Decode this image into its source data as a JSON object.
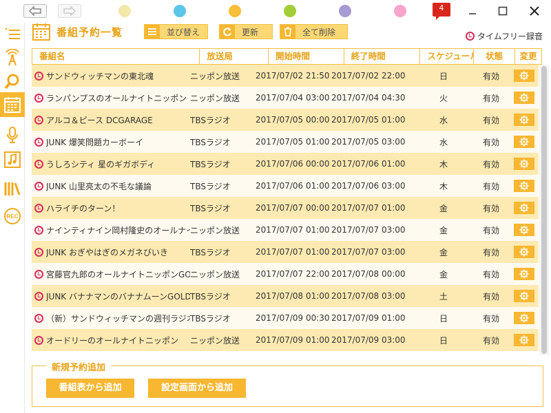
{
  "titlebar": {
    "back_icon": "back-arrow-icon",
    "forward_icon": "forward-arrow-icon",
    "theme_colors": [
      "#f3e7aa",
      "#5bc6e8",
      "#f7be3a",
      "#a2cf36",
      "#a89ad2",
      "#f8a4cc"
    ],
    "notification_count": "4"
  },
  "rail": {
    "items": [
      "menu-icon",
      "radio-antenna-icon",
      "search-icon",
      "calendar-icon",
      "microphone-icon",
      "music-note-icon",
      "library-icon",
      "rec-icon"
    ],
    "active_index": 3,
    "rec_label": "REC"
  },
  "header": {
    "title": "番組予約一覧",
    "sort_label": "並び替え",
    "refresh_label": "更新",
    "delete_all_label": "全て削除",
    "timefree_label": "タイムフリー録音"
  },
  "table": {
    "columns": [
      "番組名",
      "放送局",
      "開始時間",
      "終了時間",
      "スケジュール",
      "状態",
      "変更"
    ],
    "rows": [
      {
        "name": "サンドウィッチマンの東北魂",
        "station": "ニッポン放送",
        "start": "2017/07/02 21:50",
        "end": "2017/07/02 22:00",
        "schedule": "日",
        "status": "有効"
      },
      {
        "name": "ランパンプスのオールナイトニッポン",
        "station": "ニッポン放送",
        "start": "2017/07/04 03:00",
        "end": "2017/07/04 04:30",
        "schedule": "火",
        "status": "有効"
      },
      {
        "name": "アルコ＆ピース DCGARAGE",
        "station": "TBSラジオ",
        "start": "2017/07/05 00:00",
        "end": "2017/07/05 01:00",
        "schedule": "水",
        "status": "有効"
      },
      {
        "name": "JUNK 爆笑問題カーボーイ",
        "station": "TBSラジオ",
        "start": "2017/07/05 01:00",
        "end": "2017/07/05 03:00",
        "schedule": "水",
        "status": "有効"
      },
      {
        "name": "うしろシティ 星のギガボディ",
        "station": "TBSラジオ",
        "start": "2017/07/06 00:00",
        "end": "2017/07/06 01:00",
        "schedule": "木",
        "status": "有効"
      },
      {
        "name": "JUNK 山里亮太の不毛な議論",
        "station": "TBSラジオ",
        "start": "2017/07/06 01:00",
        "end": "2017/07/06 03:00",
        "schedule": "木",
        "status": "有効"
      },
      {
        "name": "ハライチのターン！",
        "station": "TBSラジオ",
        "start": "2017/07/07 00:00",
        "end": "2017/07/07 01:00",
        "schedule": "金",
        "status": "有効"
      },
      {
        "name": "ナインティナイン岡村隆史のオールナイ",
        "station": "ニッポン放送",
        "start": "2017/07/07 01:00",
        "end": "2017/07/07 03:00",
        "schedule": "金",
        "status": "有効"
      },
      {
        "name": "JUNK おぎやはぎのメガネびいき",
        "station": "TBSラジオ",
        "start": "2017/07/07 01:00",
        "end": "2017/07/07 03:00",
        "schedule": "金",
        "status": "有効"
      },
      {
        "name": "宮藤官九郎のオールナイトニッポンGO",
        "station": "ニッポン放送",
        "start": "2017/07/07 22:00",
        "end": "2017/07/08 00:00",
        "schedule": "金",
        "status": "有効"
      },
      {
        "name": "JUNK バナナマンのバナナムーンGOLD",
        "station": "TBSラジオ",
        "start": "2017/07/08 01:00",
        "end": "2017/07/08 03:00",
        "schedule": "土",
        "status": "有効"
      },
      {
        "name": "（新）サンドウィッチマンの週刊ラジオ",
        "station": "TBSラジオ",
        "start": "2017/07/09 00:30",
        "end": "2017/07/09 01:00",
        "schedule": "日",
        "status": "有効"
      },
      {
        "name": "オードリーのオールナイトニッポン",
        "station": "ニッポン放送",
        "start": "2017/07/09 01:00",
        "end": "2017/07/09 03:00",
        "schedule": "日",
        "status": "有効"
      }
    ]
  },
  "add_section": {
    "title": "新規予約追加",
    "from_guide_label": "番組表から追加",
    "from_settings_label": "設定画面から追加"
  }
}
